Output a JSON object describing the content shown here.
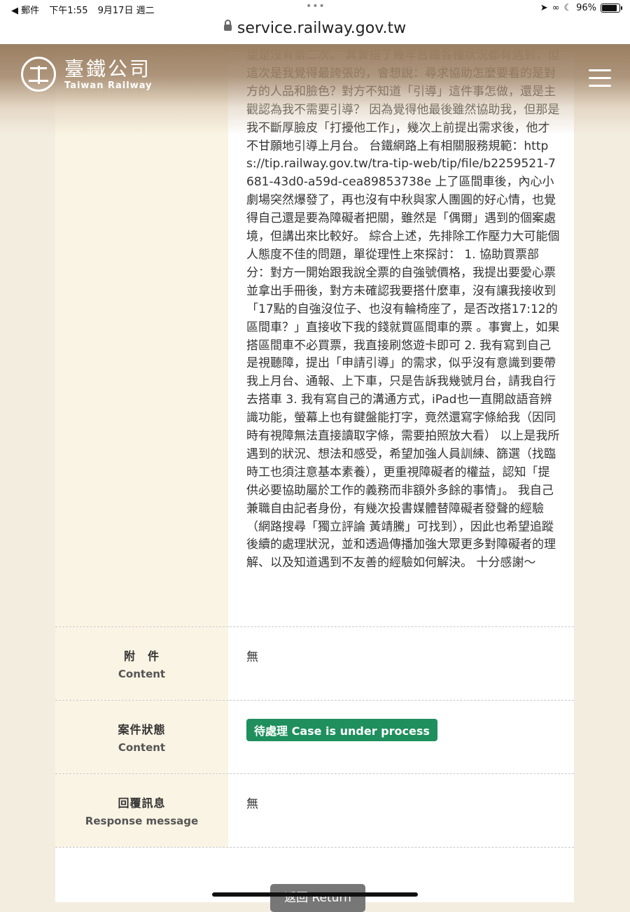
{
  "status_bar": {
    "back_app": "◀ 郵件",
    "time": "下午1:55",
    "date": "9月17日 週二",
    "battery": "96%",
    "battery_level": 0.96
  },
  "browser": {
    "url": "service.railway.gov.tw"
  },
  "header": {
    "logo_cn": "臺鐵公司",
    "logo_en": "Taiwan Railway"
  },
  "message": {
    "text": "望是沒有第二次。 其實搭了幾年台鐵各種狀況都有遇到，但這次是我覺得最誇張的，會想說：尋求協助怎麼要看的是對方的人品和臉色？對方不知道「引導」這件事怎做，還是主觀認為我不需要引導？ 因為覺得他最後雖然協助我，但那是我不斷厚臉皮「打擾他工作」，幾次上前提出需求後，他才不甘願地引導上月台。 台鐵網路上有相關服務規範：https://tip.railway.gov.tw/tra-tip-web/tip/file/b2259521-7681-43d0-a59d-cea89853738e 上了區間車後，內心小劇場突然爆發了，再也沒有中秋與家人團圓的好心情，也覺得自己還是要為障礙者把關，雖然是「偶爾」遇到的個案處境，但講出來比較好。 綜合上述，先排除工作壓力大可能個人態度不佳的問題，單從理性上來探討： 1. 協助買票部分：對方一開始跟我說全票的自強號價格，我提出要愛心票並拿出手冊後，對方未確認我要搭什麼車，沒有讓我接收到「17點的自強沒位子、也沒有輪椅座了，是否改搭17:12的區間車？」直接收下我的錢就買區間車的票 。事實上，如果搭區間車不必買票，我直接刷悠遊卡即可 2. 我有寫到自己是視聽障，提出「申請引導」的需求，似乎沒有意識到要帶我上月台、通報、上下車，只是告訴我幾號月台，請我自行去搭車 3. 我有寫自己的溝通方式，iPad也一直開啟語音辨識功能，螢幕上也有鍵盤能打字，竟然還寫字條給我（因同時有視障無法直接讀取字條，需要拍照放大看） 以上是我所遇到的狀況、想法和感受，希望加強人員訓練、篩選（找臨時工也須注意基本素養），更重視障礙者的權益，認知「提供必要協助屬於工作的義務而非額外多餘的事情」。 我自己兼職自由記者身份，有幾次投書媒體替障礙者發聲的經驗（網路搜尋「獨立評論 黃靖騰」可找到），因此也希望追蹤後續的處理狀況，並和透過傳播加強大眾更多對障礙者的理解、以及知道遇到不友善的經驗如何解決。 十分感謝～"
  },
  "rows": {
    "attachment": {
      "label": "附　件",
      "sublabel": "Content",
      "value": "無"
    },
    "status": {
      "label": "案件狀態",
      "sublabel": "Content",
      "value": "待處理 Case is under process",
      "badge_color": "#1f8f5e"
    },
    "response": {
      "label": "回覆訊息",
      "sublabel": "Response message",
      "value": "無"
    }
  },
  "actions": {
    "return_label": "返回 Return"
  }
}
